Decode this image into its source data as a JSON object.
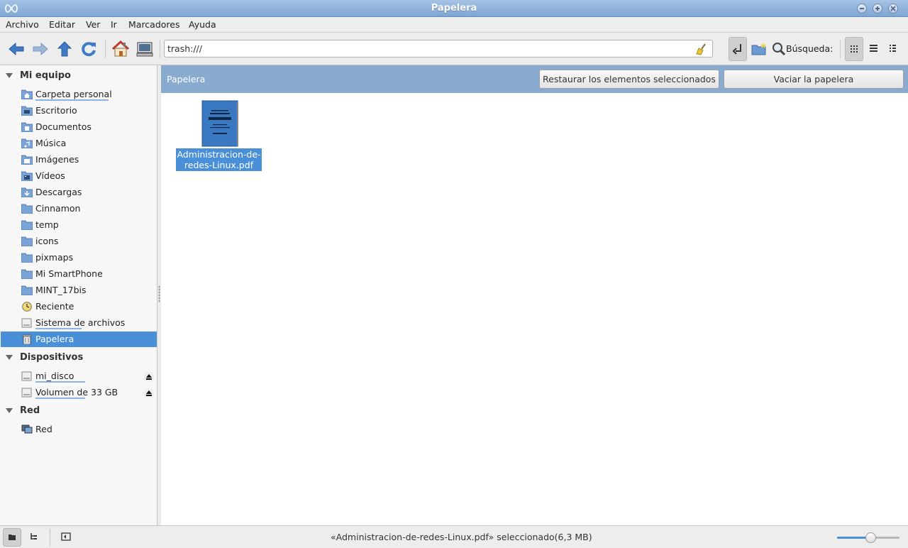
{
  "window": {
    "title": "Papelera"
  },
  "menu": [
    "Archivo",
    "Editar",
    "Ver",
    "Ir",
    "Marcadores",
    "Ayuda"
  ],
  "toolbar": {
    "location": "trash:///",
    "search_label": "Búsqueda:"
  },
  "sidebar": {
    "sections": [
      {
        "title": "Mi equipo"
      },
      {
        "title": "Dispositivos"
      },
      {
        "title": "Red"
      }
    ],
    "my_computer": [
      {
        "label": "Carpeta personal",
        "icon": "home-folder-icon"
      },
      {
        "label": "Escritorio",
        "icon": "desktop-folder-icon"
      },
      {
        "label": "Documentos",
        "icon": "documents-folder-icon"
      },
      {
        "label": "Música",
        "icon": "music-folder-icon"
      },
      {
        "label": "Imágenes",
        "icon": "pictures-folder-icon"
      },
      {
        "label": "Vídeos",
        "icon": "videos-folder-icon"
      },
      {
        "label": "Descargas",
        "icon": "downloads-folder-icon"
      },
      {
        "label": "Cinnamon",
        "icon": "folder-icon"
      },
      {
        "label": "temp",
        "icon": "folder-icon"
      },
      {
        "label": "icons",
        "icon": "folder-icon"
      },
      {
        "label": "pixmaps",
        "icon": "folder-icon"
      },
      {
        "label": "Mi SmartPhone",
        "icon": "folder-icon"
      },
      {
        "label": "MINT_17bis",
        "icon": "folder-icon"
      },
      {
        "label": "Reciente",
        "icon": "recent-icon"
      },
      {
        "label": "Sistema de archivos",
        "icon": "filesystem-icon"
      },
      {
        "label": "Papelera",
        "icon": "trash-icon"
      }
    ],
    "devices": [
      {
        "label": "mi_disco",
        "icon": "drive-icon"
      },
      {
        "label": "Volumen de 33 GB",
        "icon": "drive-icon"
      }
    ],
    "network": [
      {
        "label": "Red",
        "icon": "network-icon"
      }
    ]
  },
  "infobar": {
    "location_label": "Papelera",
    "restore_button": "Restaurar los elementos seleccionados",
    "empty_button": "Vaciar la papelera"
  },
  "files": [
    {
      "name_line1": "Administracion-de-",
      "name_line2": "redes-Linux.pdf",
      "icon": "pdf-thumbnail-icon",
      "selected": true
    }
  ],
  "statusbar": {
    "text": "«Administracion-de-redes-Linux.pdf» seleccionado(6,3 MB)",
    "zoom_level": 0.53
  },
  "colors": {
    "accent": "#4a90d9",
    "infobar": "#8aabd0",
    "titlebar": "#7fa6d4"
  }
}
